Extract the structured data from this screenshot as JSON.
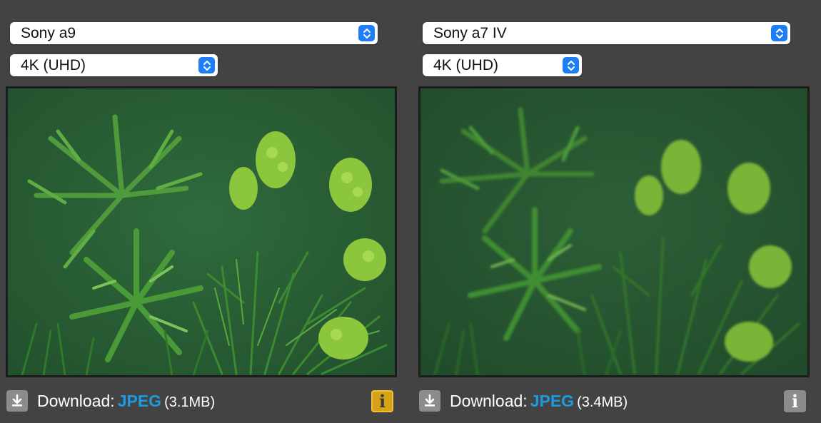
{
  "left": {
    "camera": "Sony a9",
    "resolution": "4K (UHD)",
    "download_label": "Download:",
    "format": "JPEG",
    "size": "(3.1MB)",
    "info_icon": "info-icon",
    "info_active": true
  },
  "right": {
    "camera": "Sony a7 IV",
    "resolution": "4K (UHD)",
    "download_label": "Download:",
    "format": "JPEG",
    "size": "(3.4MB)",
    "info_icon": "info-icon",
    "info_active": false
  },
  "colors": {
    "background": "#434343",
    "link": "#1d9ae0",
    "select_arrow": "#1e7ef7",
    "info_active": "#d7a316",
    "info_inactive": "#8c8c8c",
    "foliage_dark": "#2d5a35",
    "foliage_light": "#6fb23c"
  }
}
